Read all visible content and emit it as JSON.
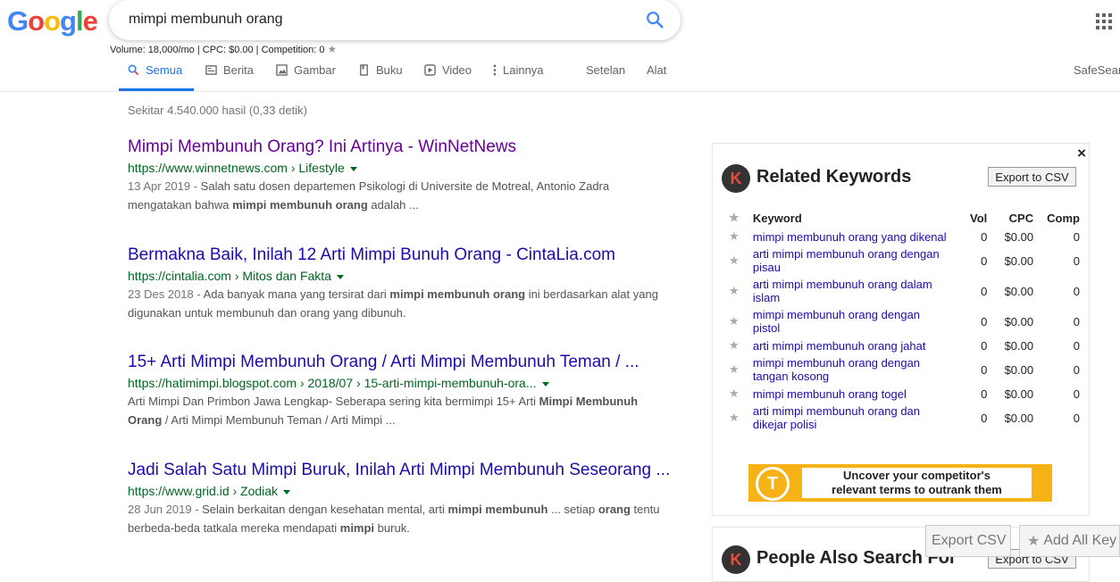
{
  "logo": {
    "letters": [
      "G",
      "o",
      "o",
      "g",
      "l",
      "e"
    ],
    "colors": [
      "#4285f4",
      "#ea4335",
      "#fbbc05",
      "#4285f4",
      "#34a853",
      "#ea4335"
    ]
  },
  "search": {
    "value": "mimpi membunuh orang",
    "icon": "search-icon"
  },
  "volume_line": "Volume: 18,000/mo | CPC: $0.00 | Competition: 0",
  "tabs": [
    {
      "label": "Semua",
      "icon": "search-icon"
    },
    {
      "label": "Berita",
      "icon": "news-icon"
    },
    {
      "label": "Gambar",
      "icon": "image-icon"
    },
    {
      "label": "Buku",
      "icon": "book-icon"
    },
    {
      "label": "Video",
      "icon": "play-icon"
    },
    {
      "label": "Lainnya",
      "icon": "more-vert-icon"
    },
    {
      "label": "Setelan"
    },
    {
      "label": "Alat"
    }
  ],
  "safesearch": "SafeSear",
  "stats": "Sekitar 4.540.000 hasil (0,33 detik)",
  "results": [
    {
      "title": "Mimpi Membunuh Orang? Ini Artinya - WinNetNews",
      "url": "https://www.winnetnews.com › Lifestyle",
      "date": "13 Apr 2019 - ",
      "snippet": [
        {
          "t": "Salah satu dosen departemen Psikologi di Universite de Motreal, Antonio Zadra mengatakan bahwa ",
          "b": false
        },
        {
          "t": "mimpi membunuh orang",
          "b": true
        },
        {
          "t": " adalah ...",
          "b": false
        }
      ]
    },
    {
      "title": "Bermakna Baik, Inilah 12 Arti Mimpi Bunuh Orang - CintaLia.com",
      "url": "https://cintalia.com › Mitos dan Fakta",
      "date": "23 Des 2018 - ",
      "snippet": [
        {
          "t": "Ada banyak mana yang tersirat dari ",
          "b": false
        },
        {
          "t": "mimpi membunuh orang",
          "b": true
        },
        {
          "t": " ini berdasarkan alat yang digunakan untuk membunuh dan orang yang dibunuh.",
          "b": false
        }
      ]
    },
    {
      "title": "15+ Arti Mimpi Membunuh Orang / Arti Mimpi Membunuh Teman / ...",
      "url": "https://hatimimpi.blogspot.com › 2018/07 › 15-arti-mimpi-membunuh-ora...",
      "date": "",
      "snippet": [
        {
          "t": "Arti Mimpi Dan Primbon Jawa Lengkap- Seberapa sering kita bermimpi 15+ Arti ",
          "b": false
        },
        {
          "t": "Mimpi Membunuh Orang",
          "b": true
        },
        {
          "t": " / Arti Mimpi Membunuh Teman / Arti Mimpi ...",
          "b": false
        }
      ]
    },
    {
      "title": "Jadi Salah Satu Mimpi Buruk, Inilah Arti Mimpi Membunuh Seseorang ...",
      "url": "https://www.grid.id › Zodiak",
      "date": "28 Jun 2019 - ",
      "snippet": [
        {
          "t": "Selain berkaitan dengan kesehatan mental, arti ",
          "b": false
        },
        {
          "t": "mimpi membunuh",
          "b": true
        },
        {
          "t": " ... setiap ",
          "b": false
        },
        {
          "t": "orang",
          "b": true
        },
        {
          "t": " tentu berbeda-beda tatkala mereka mendapati ",
          "b": false
        },
        {
          "t": "mimpi",
          "b": true
        },
        {
          "t": " buruk.",
          "b": false
        }
      ]
    }
  ],
  "panel": {
    "close": "×",
    "logo_letter": "K",
    "title": "Related Keywords",
    "export_label": "Export to CSV",
    "headers": {
      "keyword": "Keyword",
      "vol": "Vol",
      "cpc": "CPC",
      "comp": "Comp"
    },
    "rows": [
      {
        "keyword": "mimpi membunuh orang yang dikenal",
        "vol": "0",
        "cpc": "$0.00",
        "comp": "0"
      },
      {
        "keyword": "arti mimpi membunuh orang dengan pisau",
        "vol": "0",
        "cpc": "$0.00",
        "comp": "0"
      },
      {
        "keyword": "arti mimpi membunuh orang dalam islam",
        "vol": "0",
        "cpc": "$0.00",
        "comp": "0"
      },
      {
        "keyword": "mimpi membunuh orang dengan pistol",
        "vol": "0",
        "cpc": "$0.00",
        "comp": "0"
      },
      {
        "keyword": "arti mimpi membunuh orang jahat",
        "vol": "0",
        "cpc": "$0.00",
        "comp": "0"
      },
      {
        "keyword": "mimpi membunuh orang dengan tangan kosong",
        "vol": "0",
        "cpc": "$0.00",
        "comp": "0"
      },
      {
        "keyword": "mimpi membunuh orang togel",
        "vol": "0",
        "cpc": "$0.00",
        "comp": "0"
      },
      {
        "keyword": "arti mimpi membunuh orang dan dikejar polisi",
        "vol": "0",
        "cpc": "$0.00",
        "comp": "0"
      }
    ],
    "banner_letter": "T",
    "banner_line1": "Uncover your competitor's",
    "banner_line2": "relevant terms to outrank them"
  },
  "panel2": {
    "title": "People Also Search For",
    "export_label": "Export to CSV"
  },
  "floating": {
    "export_csv": "Export CSV",
    "add_all": "Add All Key"
  }
}
